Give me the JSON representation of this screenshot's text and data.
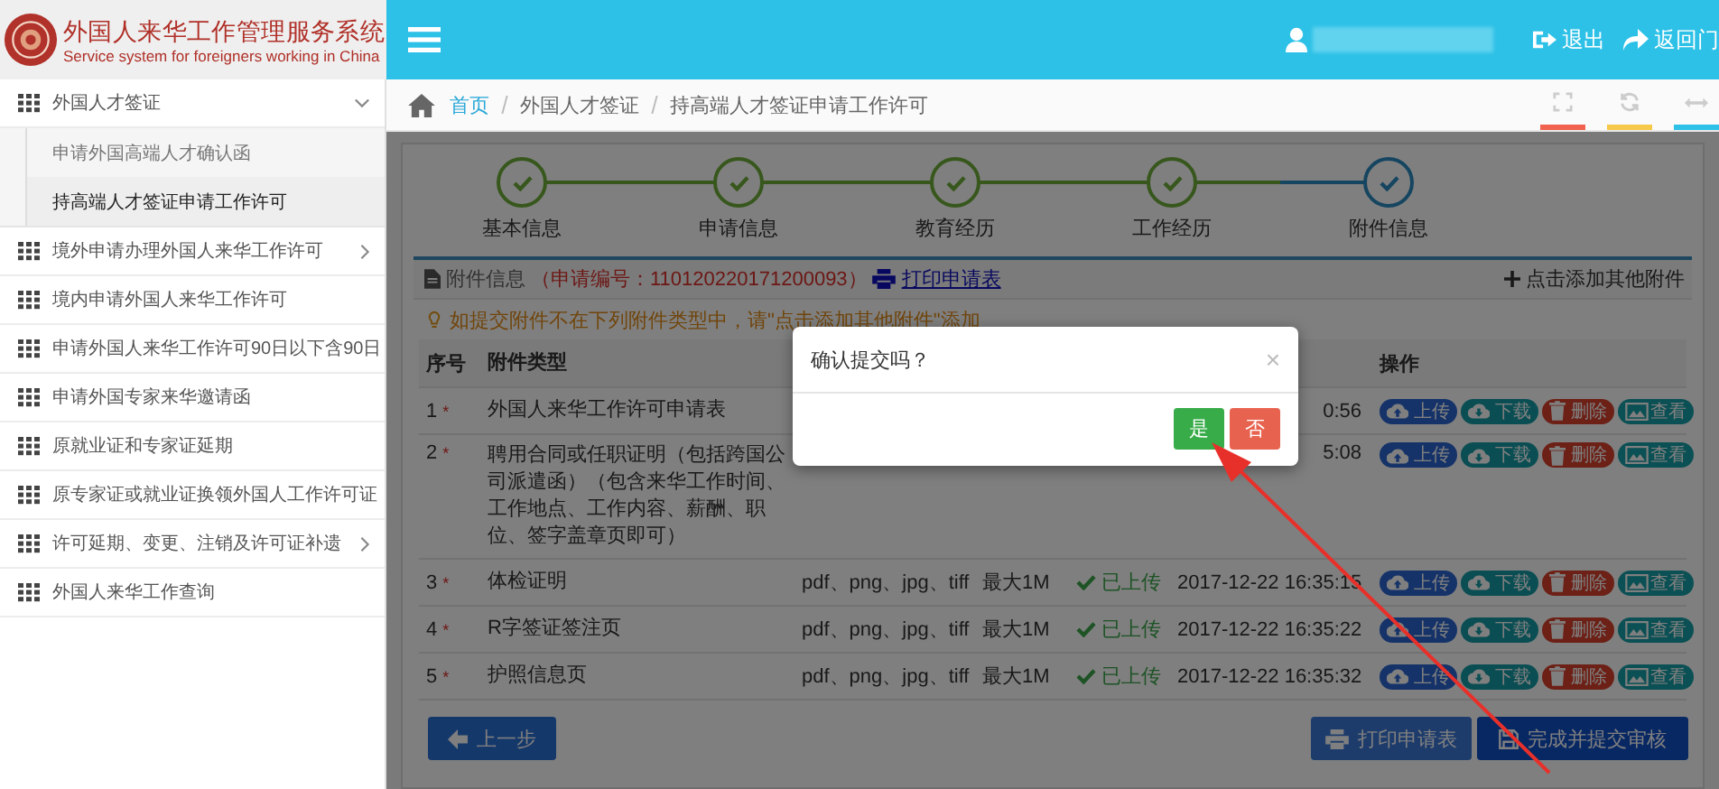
{
  "header": {
    "title": "外国人来华工作管理服务系统",
    "subtitle": "Service system for foreigners working in China",
    "links": [
      {
        "label": "退出",
        "kind": "logout"
      },
      {
        "label": "返回门",
        "kind": "portal"
      }
    ]
  },
  "sidebar": {
    "items": [
      {
        "label": "外国人才签证",
        "expanded": true,
        "children": [
          {
            "label": "申请外国高端人才确认函",
            "selected": false
          },
          {
            "label": "持高端人才签证申请工作许可",
            "selected": true
          }
        ]
      },
      {
        "label": "境外申请办理外国人来华工作许可",
        "expanded": false,
        "has_children": true
      },
      {
        "label": "境内申请外国人来华工作许可",
        "expanded": false
      },
      {
        "label": "申请外国人来华工作许可90日以下含90日",
        "expanded": false
      },
      {
        "label": "申请外国专家来华邀请函",
        "expanded": false
      },
      {
        "label": "原就业证和专家证延期",
        "expanded": false
      },
      {
        "label": "原专家证或就业证换领外国人工作许可证",
        "expanded": false
      },
      {
        "label": "许可延期、变更、注销及许可证补遗",
        "expanded": false,
        "has_children": true
      },
      {
        "label": "外国人来华工作查询",
        "expanded": false
      }
    ]
  },
  "breadcrumb": [
    "首页",
    "外国人才签证",
    "持高端人才签证申请工作许可"
  ],
  "steps": [
    {
      "label": "基本信息",
      "completed": true,
      "current": false
    },
    {
      "label": "申请信息",
      "completed": true,
      "current": false
    },
    {
      "label": "教育经历",
      "completed": true,
      "current": false
    },
    {
      "label": "工作经历",
      "completed": true,
      "current": false
    },
    {
      "label": "附件信息",
      "completed": true,
      "current": true
    }
  ],
  "panel": {
    "title": "附件信息",
    "application_no": "（申请编号：110120220171200093）",
    "print_link": "打印申请表",
    "add_link": "点击添加其他附件",
    "hint": "如提交附件不在下列附件类型中，请\"点击添加其他附件\"添加"
  },
  "table": {
    "columns": [
      "序号",
      "附件类型",
      "操作"
    ],
    "rows": [
      {
        "no": "1",
        "mark": "*",
        "type": "外国人来华工作许可申请表",
        "time": "0:56",
        "actions": [
          {
            "label": "上传",
            "kind": "upload"
          },
          {
            "label": "下载",
            "kind": "download"
          },
          {
            "label": "删除",
            "kind": "delete"
          },
          {
            "label": "查看",
            "kind": "view"
          }
        ]
      },
      {
        "no": "2",
        "mark": "*",
        "type": "聘用合同或任职证明（包括跨国公司派遣函）（包含来华工作时间、工作地点、工作内容、薪酬、职位、签字盖章页即可）",
        "time": "5:08",
        "actions": [
          {
            "label": "上传",
            "kind": "upload"
          },
          {
            "label": "下载",
            "kind": "download"
          },
          {
            "label": "删除",
            "kind": "delete"
          },
          {
            "label": "查看",
            "kind": "view"
          }
        ]
      },
      {
        "no": "3",
        "mark": "*",
        "type": "体检证明",
        "format": "pdf、png、jpg、tiff",
        "size": "最大1M",
        "status": "已上传",
        "uploaded": true,
        "time": "2017-12-22 16:35:15",
        "actions": [
          {
            "label": "上传",
            "kind": "upload"
          },
          {
            "label": "下载",
            "kind": "download"
          },
          {
            "label": "删除",
            "kind": "delete"
          },
          {
            "label": "查看",
            "kind": "view"
          }
        ]
      },
      {
        "no": "4",
        "mark": "*",
        "type": "R字签证签注页",
        "format": "pdf、png、jpg、tiff",
        "size": "最大1M",
        "status": "已上传",
        "uploaded": true,
        "time": "2017-12-22 16:35:22",
        "actions": [
          {
            "label": "上传",
            "kind": "upload"
          },
          {
            "label": "下载",
            "kind": "download"
          },
          {
            "label": "删除",
            "kind": "delete"
          },
          {
            "label": "查看",
            "kind": "view"
          }
        ]
      },
      {
        "no": "5",
        "mark": "*",
        "type": "护照信息页",
        "format": "pdf、png、jpg、tiff",
        "size": "最大1M",
        "status": "已上传",
        "uploaded": true,
        "time": "2017-12-22 16:35:32",
        "actions": [
          {
            "label": "上传",
            "kind": "upload"
          },
          {
            "label": "下载",
            "kind": "download"
          },
          {
            "label": "删除",
            "kind": "delete"
          },
          {
            "label": "查看",
            "kind": "view"
          }
        ]
      }
    ]
  },
  "footer_buttons": [
    {
      "label": "上一步",
      "kind": "back"
    },
    {
      "label": "打印申请表",
      "kind": "print"
    },
    {
      "label": "完成并提交审核",
      "kind": "submit"
    }
  ],
  "dialog": {
    "message": "确认提交吗？",
    "close": "×",
    "buttons": [
      {
        "label": "是",
        "kind": "confirm"
      },
      {
        "label": "否",
        "kind": "cancel"
      }
    ]
  }
}
